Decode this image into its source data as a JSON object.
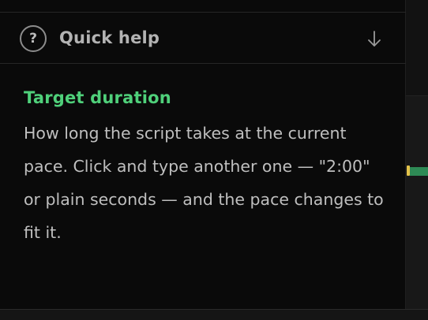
{
  "help_panel": {
    "title": "Quick help",
    "icon_glyph": "?",
    "icon": "question-circle-icon",
    "collapse_icon": "arrow-down-icon"
  },
  "section": {
    "heading": "Target duration",
    "description": "How long the script takes at the current pace. Click and type another one — \"2:00\" or plain seconds — and the pace changes to fit it."
  },
  "colors": {
    "heading_accent": "#4fd07a",
    "timeline_marker": "#e3c24a",
    "timeline_bar": "#2e8a55"
  }
}
